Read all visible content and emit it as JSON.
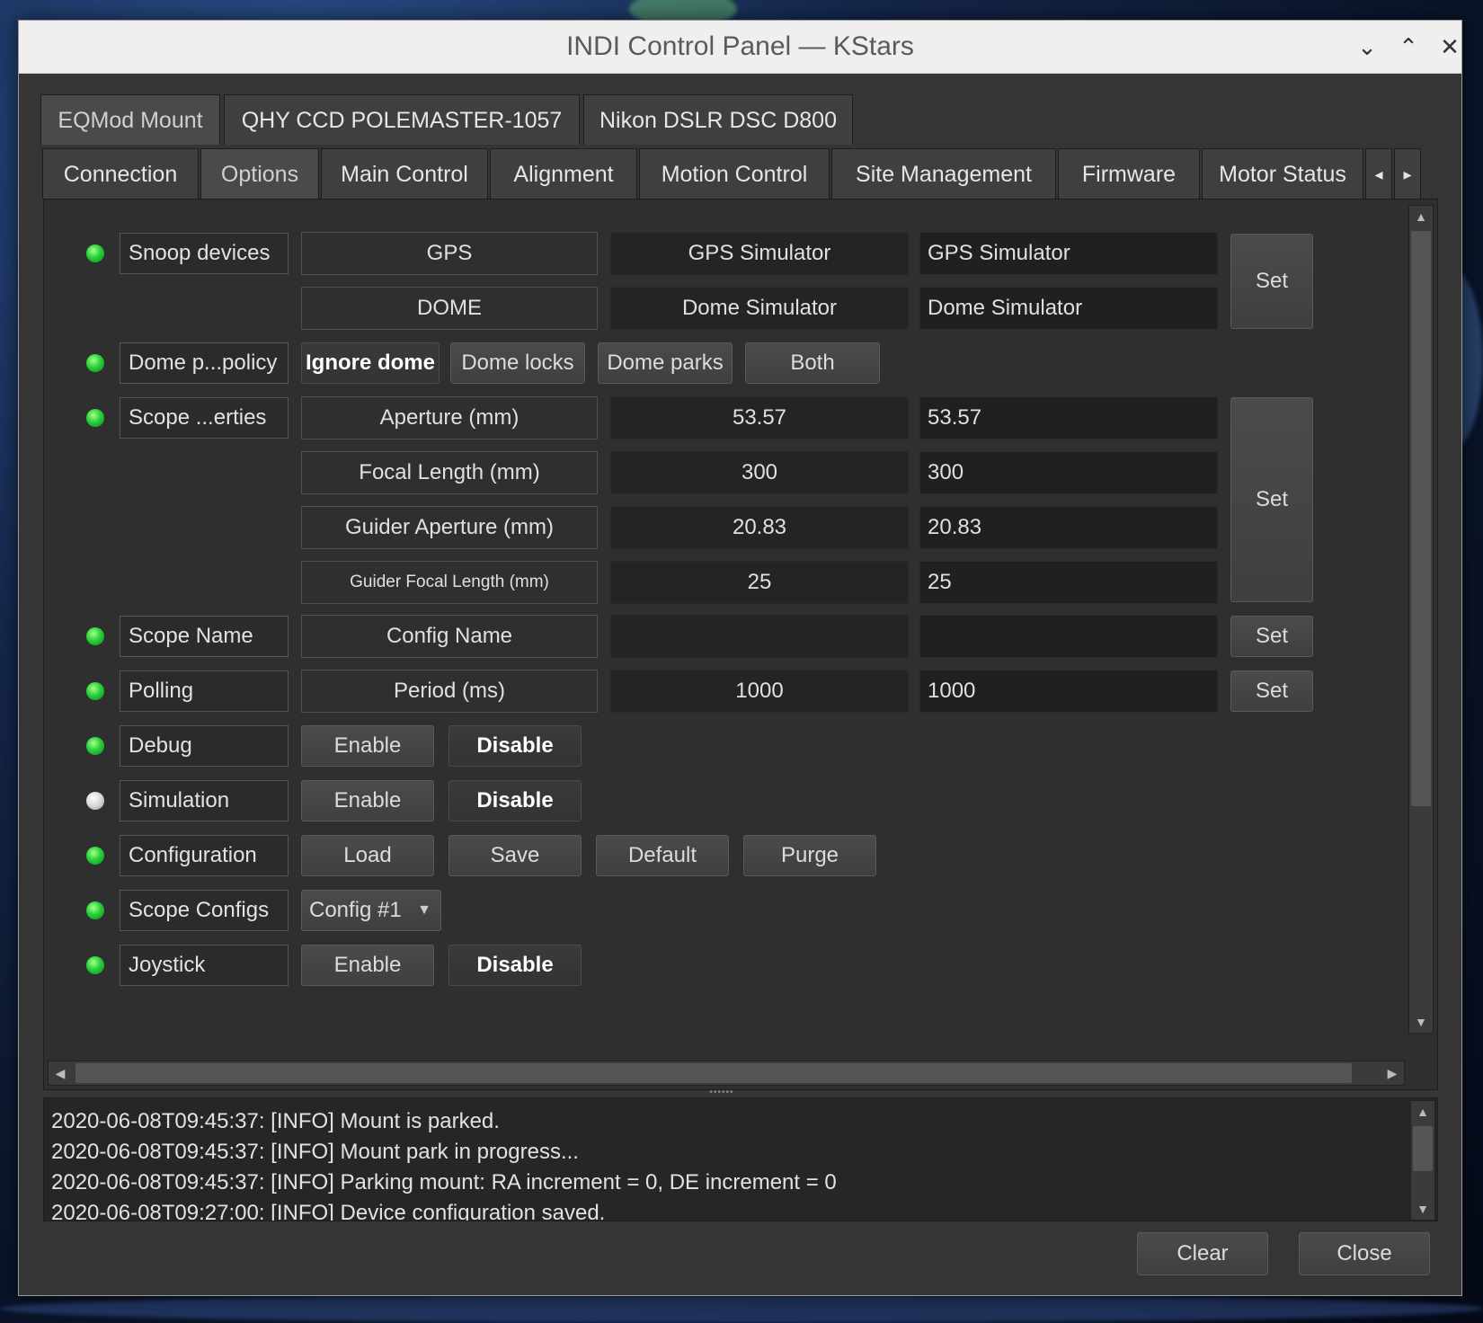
{
  "window": {
    "title": "INDI Control Panel — KStars",
    "controls": {
      "minimize": "⌄",
      "maximize": "⌃",
      "close": "✕"
    }
  },
  "device_tabs": [
    {
      "label": "EQMod Mount",
      "active": true
    },
    {
      "label": "QHY CCD POLEMASTER-1057",
      "active": false
    },
    {
      "label": "Nikon DSLR DSC D800",
      "active": false
    }
  ],
  "group_tabs": [
    {
      "label": "Connection",
      "active": false
    },
    {
      "label": "Options",
      "active": true
    },
    {
      "label": "Main Control",
      "active": false
    },
    {
      "label": "Alignment",
      "active": false
    },
    {
      "label": "Motion Control",
      "active": false
    },
    {
      "label": "Site Management",
      "active": false
    },
    {
      "label": "Firmware",
      "active": false
    },
    {
      "label": "Motor Status",
      "active": false
    }
  ],
  "properties": {
    "snoop": {
      "label": "Snoop devices",
      "state": "ok",
      "rows": [
        {
          "name": "GPS",
          "current": "GPS Simulator",
          "input": "GPS Simulator"
        },
        {
          "name": "DOME",
          "current": "Dome Simulator",
          "input": "Dome Simulator"
        }
      ],
      "set_label": "Set"
    },
    "dome_policy": {
      "label": "Dome p...policy",
      "state": "ok",
      "options": [
        "Ignore dome",
        "Dome locks",
        "Dome parks",
        "Both"
      ],
      "selected": "Ignore dome"
    },
    "scope_properties": {
      "label": "Scope ...erties",
      "state": "ok",
      "rows": [
        {
          "name": "Aperture (mm)",
          "current": "53.57",
          "input": "53.57"
        },
        {
          "name": "Focal Length (mm)",
          "current": "300",
          "input": "300"
        },
        {
          "name": "Guider Aperture (mm)",
          "current": "20.83",
          "input": "20.83"
        },
        {
          "name": "Guider Focal Length (mm)",
          "current": "25",
          "input": "25"
        }
      ],
      "set_label": "Set"
    },
    "scope_name": {
      "label": "Scope Name",
      "state": "ok",
      "row": {
        "name": "Config Name",
        "current": "",
        "input": ""
      },
      "set_label": "Set"
    },
    "polling": {
      "label": "Polling",
      "state": "ok",
      "row": {
        "name": "Period (ms)",
        "current": "1000",
        "input": "1000"
      },
      "set_label": "Set"
    },
    "debug": {
      "label": "Debug",
      "state": "ok",
      "enable": "Enable",
      "disable": "Disable",
      "selected": "Disable"
    },
    "simulation": {
      "label": "Simulation",
      "state": "idle",
      "enable": "Enable",
      "disable": "Disable",
      "selected": "Disable"
    },
    "configuration": {
      "label": "Configuration",
      "state": "ok",
      "buttons": [
        "Load",
        "Save",
        "Default",
        "Purge"
      ]
    },
    "scope_configs": {
      "label": "Scope Configs",
      "state": "ok",
      "value": "Config #1"
    },
    "joystick": {
      "label": "Joystick",
      "state": "ok",
      "enable": "Enable",
      "disable": "Disable",
      "selected": "Disable"
    }
  },
  "log": [
    "2020-06-08T09:45:37: [INFO] Mount is parked.",
    "2020-06-08T09:45:37: [INFO] Mount park in progress...",
    "2020-06-08T09:45:37: [INFO] Parking mount: RA increment = 0, DE increment = 0",
    "2020-06-08T09:27:00: [INFO] Device configuration saved."
  ],
  "footer": {
    "clear": "Clear",
    "close": "Close"
  },
  "colors": {
    "led_ok": "#28d03a",
    "led_idle": "#d8d8d8",
    "panel_bg": "#353535",
    "title_bg": "#efefef"
  }
}
